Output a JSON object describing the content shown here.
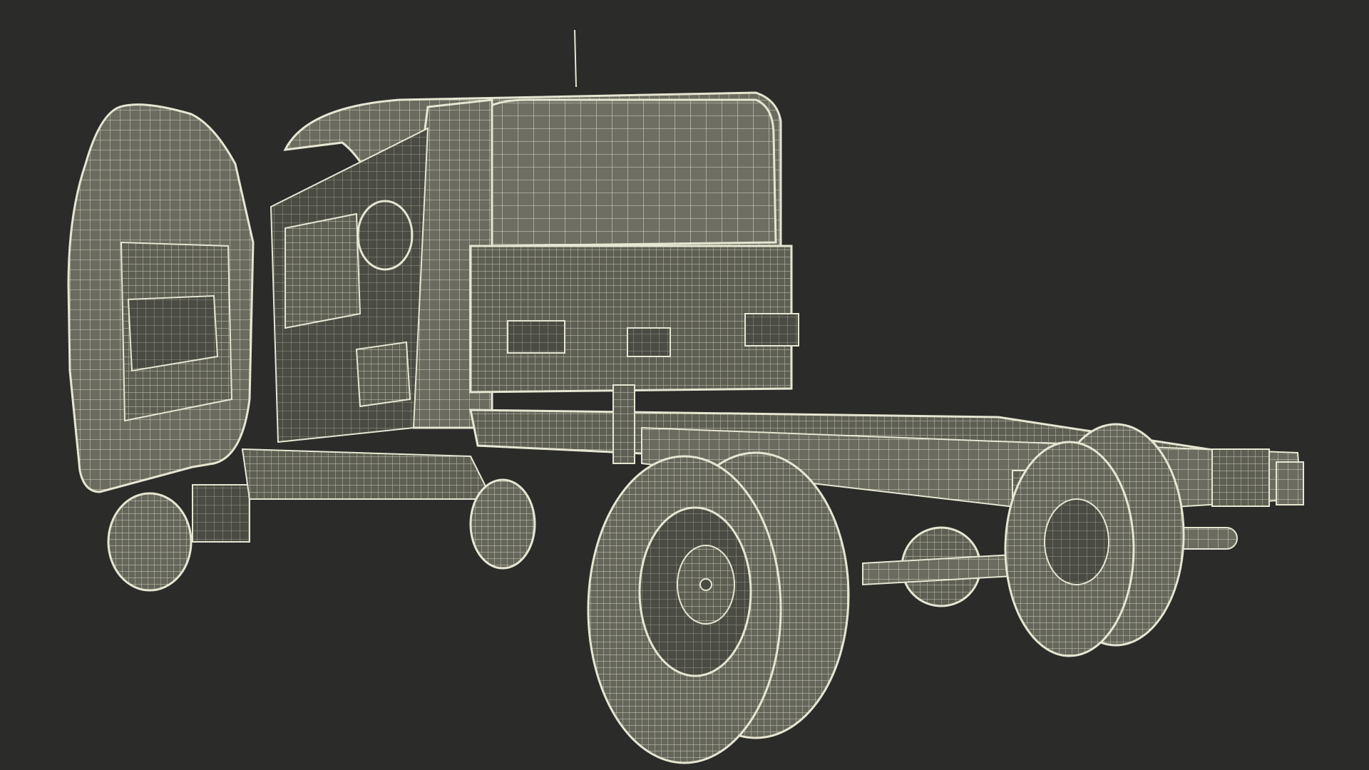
{
  "viewport": {
    "background_color": "#2b2b2a",
    "model_fill_color": "#6b6b5f",
    "model_shade_color": "#55564b",
    "wire_color": "#e6e6d2"
  },
  "model": {
    "subject": "truck-chassis-cab-wireframe",
    "render_mode": "wireframe-on-shaded"
  }
}
